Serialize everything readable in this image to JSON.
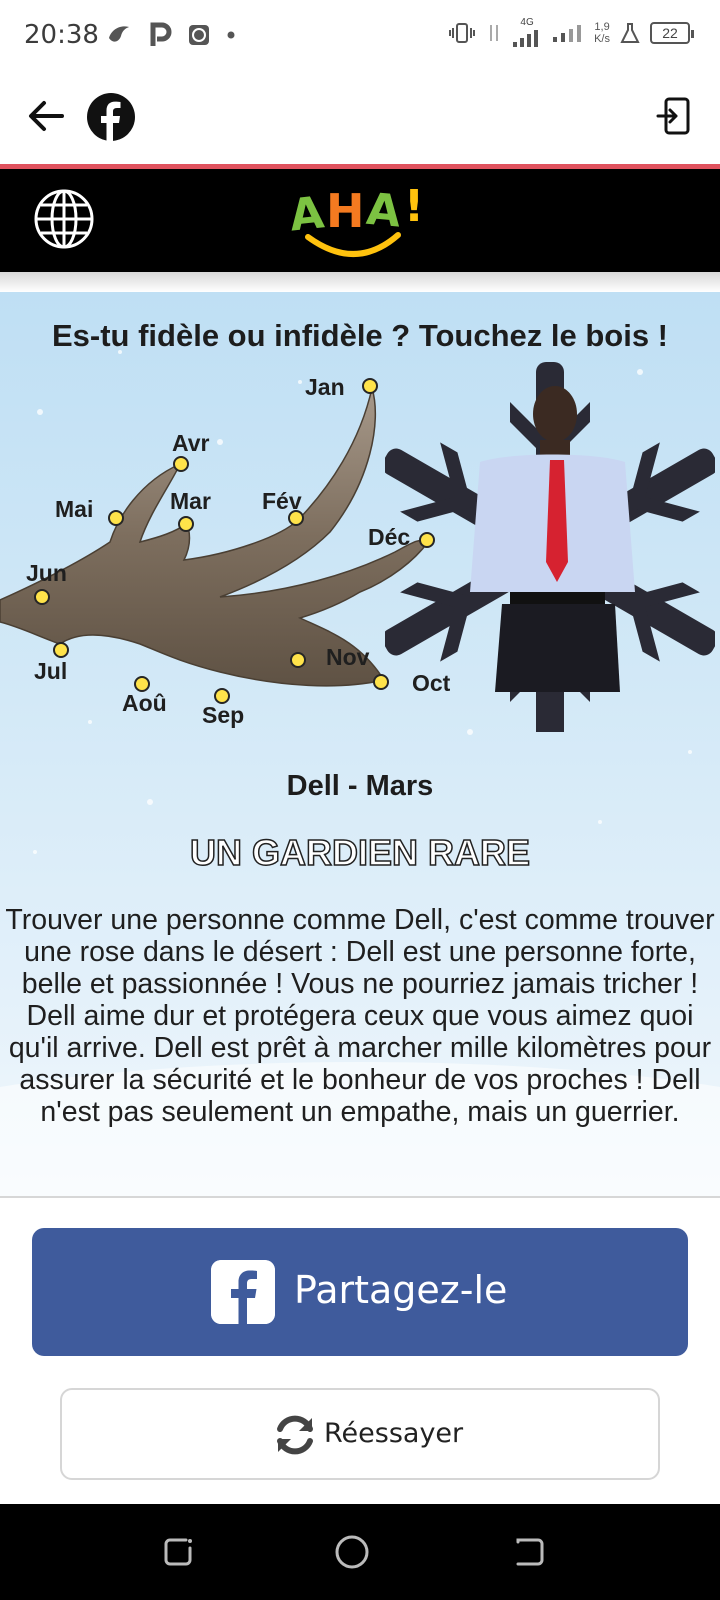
{
  "status_bar": {
    "time": "20:38",
    "network": "4G",
    "speed_value": "1,9",
    "speed_unit": "K/s",
    "battery": "22"
  },
  "app_bar": {
    "back_icon": "arrow-left-icon",
    "brand_icon": "facebook-icon",
    "exit_icon": "exit-icon"
  },
  "site_header": {
    "logo_text": "AHA!",
    "globe_icon": "globe-icon"
  },
  "card": {
    "title": "Es-tu fidèle ou infidèle ? Touchez le bois !",
    "months": {
      "jan": "Jan",
      "fev": "Fév",
      "mar": "Mar",
      "avr": "Avr",
      "mai": "Mai",
      "jun": "Jun",
      "jul": "Jul",
      "aou": "Aoû",
      "sep": "Sep",
      "oct": "Oct",
      "nov": "Nov",
      "dec": "Déc"
    },
    "result_name": "Dell - Mars",
    "result_title": "UN GARDIEN RARE",
    "result_text": "Trouver une personne comme Dell, c'est comme trouver une rose dans le désert : Dell est une personne forte, belle et passionnée ! Vous ne pourriez jamais tricher ! Dell aime dur et protégera ceux que vous aimez quoi qu'il arrive. Dell est prêt à marcher mille kilomètres pour assurer la sécurité et le bonheur de vos proches ! Dell n'est pas seulement un empathe, mais un guerrier."
  },
  "buttons": {
    "share_label": "Partagez-le",
    "retry_label": "Réessayer"
  },
  "colors": {
    "facebook_blue": "#3f5b9c",
    "dot_yellow": "#ffe34a",
    "tie_red": "#d62230",
    "header_black": "#000000"
  }
}
